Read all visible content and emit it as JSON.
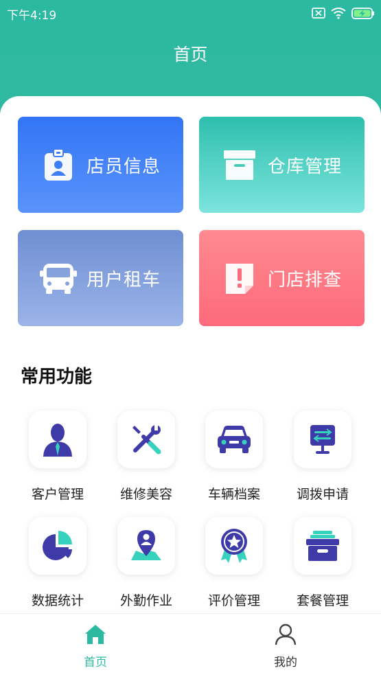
{
  "status_bar": {
    "time": "下午4:19"
  },
  "header": {
    "title": "首页"
  },
  "cards": [
    {
      "label": "店员信息",
      "icon": "badge-icon"
    },
    {
      "label": "仓库管理",
      "icon": "archive-box-icon"
    },
    {
      "label": "用户租车",
      "icon": "bus-icon"
    },
    {
      "label": "门店排查",
      "icon": "alert-note-icon"
    }
  ],
  "section": {
    "title": "常用功能"
  },
  "functions": [
    {
      "label": "客户管理",
      "icon": "person-icon"
    },
    {
      "label": "维修美容",
      "icon": "wrench-screwdriver-icon"
    },
    {
      "label": "车辆档案",
      "icon": "car-icon"
    },
    {
      "label": "调拨申请",
      "icon": "monitor-transfer-icon"
    },
    {
      "label": "数据统计",
      "icon": "pie-chart-icon"
    },
    {
      "label": "外勤作业",
      "icon": "map-pin-person-icon"
    },
    {
      "label": "评价管理",
      "icon": "star-medal-icon"
    },
    {
      "label": "套餐管理",
      "icon": "storage-box-icon"
    }
  ],
  "bottom_nav": [
    {
      "label": "首页",
      "active": true,
      "icon": "home-icon"
    },
    {
      "label": "我的",
      "active": false,
      "icon": "user-icon"
    }
  ],
  "colors": {
    "header": "#2cb9a1",
    "accent": "#2cb9a1",
    "icon_primary": "#3e3ba8",
    "icon_secondary": "#36d2bd"
  }
}
